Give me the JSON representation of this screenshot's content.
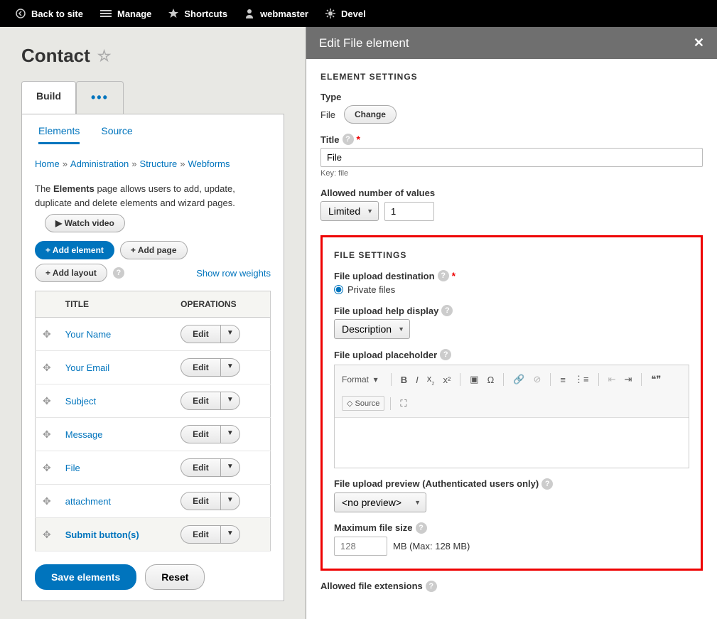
{
  "toolbar": {
    "back": "Back to site",
    "manage": "Manage",
    "shortcuts": "Shortcuts",
    "user": "webmaster",
    "devel": "Devel"
  },
  "page": {
    "title": "Contact",
    "tab_build": "Build",
    "subtab_elements": "Elements",
    "subtab_source": "Source"
  },
  "breadcrumb": {
    "home": "Home",
    "admin": "Administration",
    "structure": "Structure",
    "webforms": "Webforms"
  },
  "help": {
    "text_prefix": "The ",
    "text_strong": "Elements",
    "text_suffix": " page allows users to add, update, duplicate and delete elements and wizard pages.",
    "watch_video": "▶ Watch video"
  },
  "actions": {
    "add_element": "+ Add element",
    "add_page": "+ Add page",
    "add_layout": "+ Add layout",
    "row_weights": "Show row weights"
  },
  "table": {
    "col_title": "TITLE",
    "col_ops": "OPERATIONS",
    "edit": "Edit",
    "rows": [
      {
        "label": "Your Name"
      },
      {
        "label": "Your Email"
      },
      {
        "label": "Subject"
      },
      {
        "label": "Message"
      },
      {
        "label": "File"
      },
      {
        "label": "attachment"
      },
      {
        "label": "Submit button(s)"
      }
    ]
  },
  "buttons": {
    "save": "Save elements",
    "reset": "Reset"
  },
  "panel": {
    "title": "Edit File element",
    "section_element": "ELEMENT SETTINGS",
    "type_label": "Type",
    "type_value": "File",
    "change": "Change",
    "title_label": "Title",
    "title_value": "File",
    "key_hint": "Key: file",
    "allowed_label": "Allowed number of values",
    "limited": "Limited",
    "limited_value": "1",
    "section_file": "FILE SETTINGS",
    "dest_label": "File upload destination",
    "dest_option": "Private files",
    "help_display_label": "File upload help display",
    "help_display_value": "Description",
    "placeholder_label": "File upload placeholder",
    "rte_format": "Format",
    "rte_source": "Source",
    "preview_label": "File upload preview (Authenticated users only)",
    "preview_value": "<no preview>",
    "max_label": "Maximum file size",
    "max_placeholder": "128",
    "max_suffix": "MB (Max: 128 MB)",
    "ext_label": "Allowed file extensions"
  }
}
